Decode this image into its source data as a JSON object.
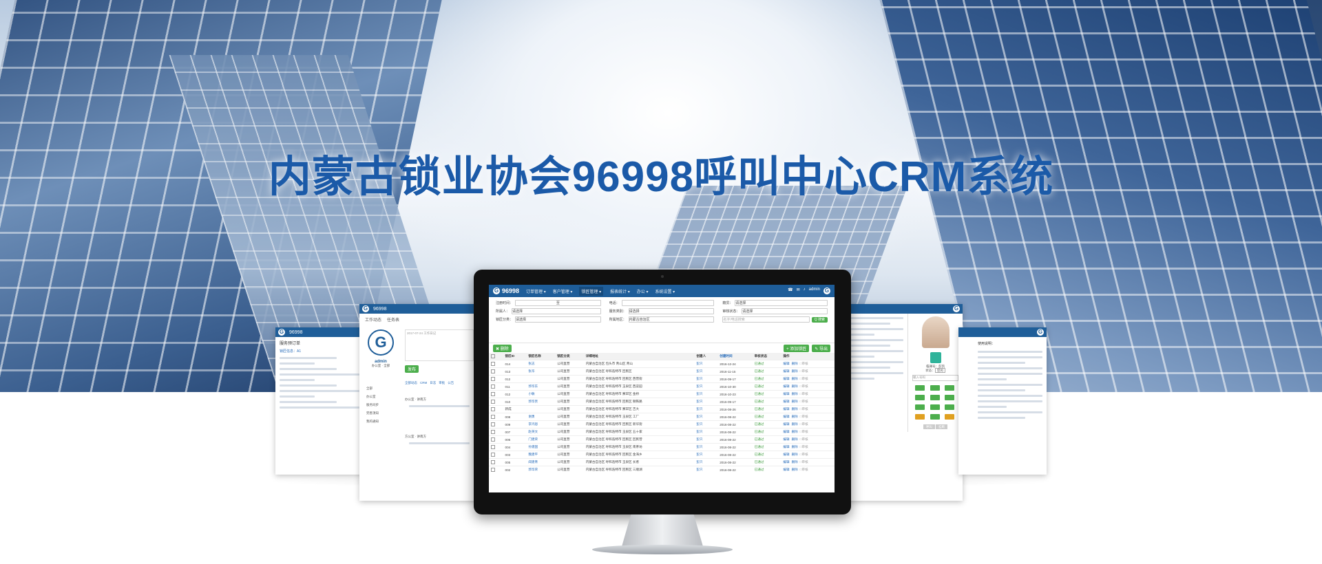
{
  "headline": "内蒙古锁业协会96998呼叫中心CRM系统",
  "brand": {
    "logo_letter": "G",
    "name": "96998"
  },
  "main_screen": {
    "nav": {
      "menus": [
        "订单管理 ▾",
        "客户管理 ▾",
        "锁匠管理 ▾",
        "报表统计 ▾",
        "办公 ▾",
        "系统设置 ▾"
      ],
      "user": "admin"
    },
    "filters": {
      "labels": [
        "注册时间：",
        "电话：",
        "籍贯：",
        "所属人：",
        "服务类别：",
        "审核状态：",
        "锁匠分类：",
        "所属地区：",
        ""
      ],
      "values": [
        "至",
        "",
        "请选择",
        "请选择",
        "请选择",
        "请选择",
        "请选择",
        "内蒙古自治区",
        "名字/电话搜索"
      ],
      "search_label": "Q 搜索"
    },
    "toolbar": {
      "delete_label": "✖ 删除",
      "add_label": "+ 添加锁匠",
      "export_label": "✎ 导出"
    },
    "columns": [
      "锁匠ID",
      "锁匠名称",
      "锁匠分类",
      "详细地址",
      "",
      "创建人",
      "创建时间",
      "审核状态",
      "操作"
    ],
    "rows": [
      {
        "id": "014",
        "name": "张志",
        "type": "公司直营",
        "addr": "内蒙古自治区 包头市 青山区 青山",
        "by": "彭只",
        "date": "2016-12-24",
        "status": "已通过"
      },
      {
        "id": "013",
        "name": "张华",
        "type": "公司直营",
        "addr": "内蒙古自治区 呼和浩特市 回民区",
        "by": "彭只",
        "date": "2016-11-15",
        "status": "已通过"
      },
      {
        "id": "012",
        "name": "",
        "type": "公司直营",
        "addr": "内蒙古自治区 呼和浩特市 回民区 西营街",
        "by": "彭只",
        "date": "2016-09-17",
        "status": "已通过"
      },
      {
        "id": "011",
        "name": "郭华东",
        "type": "公司直营",
        "addr": "内蒙古自治区 呼和浩特市 玉泉区 西菜园",
        "by": "彭只",
        "date": "2016-10-30",
        "status": "已通过"
      },
      {
        "id": "012",
        "name": "小敏",
        "type": "公司直营",
        "addr": "内蒙古自治区 呼和浩特市 赛罕区 金桥",
        "by": "彭只",
        "date": "2016-10-23",
        "status": "已通过"
      },
      {
        "id": "010",
        "name": "郭华贵",
        "type": "公司直营",
        "addr": "内蒙古自治区 呼和浩特市 回民区 钢铁路",
        "by": "彭只",
        "date": "2016-09-17",
        "status": "已通过"
      },
      {
        "id": "新成",
        "name": "",
        "type": "公司直营",
        "addr": "内蒙古自治区 呼和浩特市 赛罕区 吉大",
        "by": "彭只",
        "date": "2016-08-26",
        "status": "已通过"
      },
      {
        "id": "008",
        "name": "谢勇",
        "type": "公司直营",
        "addr": "内蒙古自治区 呼和浩特市 玉泉区 工厂",
        "by": "彭只",
        "date": "2016-08-22",
        "status": "已通过"
      },
      {
        "id": "009",
        "name": "李鸿恩",
        "type": "公司直营",
        "addr": "内蒙古自治区 呼和浩特市 回民区 新华街",
        "by": "彭只",
        "date": "2016-08-22",
        "status": "已通过"
      },
      {
        "id": "007",
        "name": "赵英文",
        "type": "公司直营",
        "addr": "内蒙古自治区 呼和浩特市 玉泉区 五十家",
        "by": "彭只",
        "date": "2016-08-22",
        "status": "已通过"
      },
      {
        "id": "006",
        "name": "门建荣",
        "type": "公司直营",
        "addr": "内蒙古自治区 呼和浩特市 回民区 回民营",
        "by": "彭只",
        "date": "2016-08-22",
        "status": "已通过"
      },
      {
        "id": "004",
        "name": "孙建国",
        "type": "公司直营",
        "addr": "内蒙古自治区 呼和浩特市 玉泉区 南茶坊",
        "by": "彭只",
        "date": "2016-08-22",
        "status": "已通过"
      },
      {
        "id": "003",
        "name": "魏建平",
        "type": "公司直营",
        "addr": "内蒙古自治区 呼和浩特市 回民区 金海乡",
        "by": "彭只",
        "date": "2016-08-22",
        "status": "已通过"
      },
      {
        "id": "005",
        "name": "阎建青",
        "type": "公司直营",
        "addr": "内蒙古自治区 呼和浩特市 玉泉区 长者",
        "by": "彭只",
        "date": "2016-08-22",
        "status": "已通过"
      },
      {
        "id": "002",
        "name": "郭华荣",
        "type": "公司直营",
        "addr": "内蒙古自治区 呼和浩特市 回民区 三顺湖",
        "by": "彭只",
        "date": "2016-08-22",
        "status": "已通过"
      }
    ],
    "row_actions": [
      "编辑",
      "删除",
      "□审核"
    ]
  },
  "left_panel": {
    "title": "服务预订单",
    "sub": "锁匠信息：A1"
  },
  "mid_left_panel": {
    "tabs": [
      "工作动态",
      "任务表"
    ],
    "user": "admin",
    "role": "办公室 · 全部",
    "side_items": [
      "全部",
      "办公室",
      "服务同步",
      "完善须知",
      "我的通知"
    ],
    "date1": "2017-07-24 工作日记",
    "send": "发布",
    "feed_tabs": [
      "全部动态",
      "CRM",
      "日志",
      "审批",
      "公告"
    ],
    "feed1": "办公室 · 讲南方",
    "feed2": "方公室 · 讲南方"
  },
  "right_panel": {
    "caller": "临澜号：彭凯",
    "status": "状态：",
    "status_value": "空闲",
    "input_ph": "输入号码",
    "keys": [
      "1",
      "2",
      "3",
      "4",
      "5",
      "6",
      "7",
      "8",
      "9",
      "*",
      "0",
      "#"
    ],
    "btns": [
      "呼叫",
      "挂断"
    ]
  },
  "far_right_panel": {
    "title": "使用说明："
  }
}
